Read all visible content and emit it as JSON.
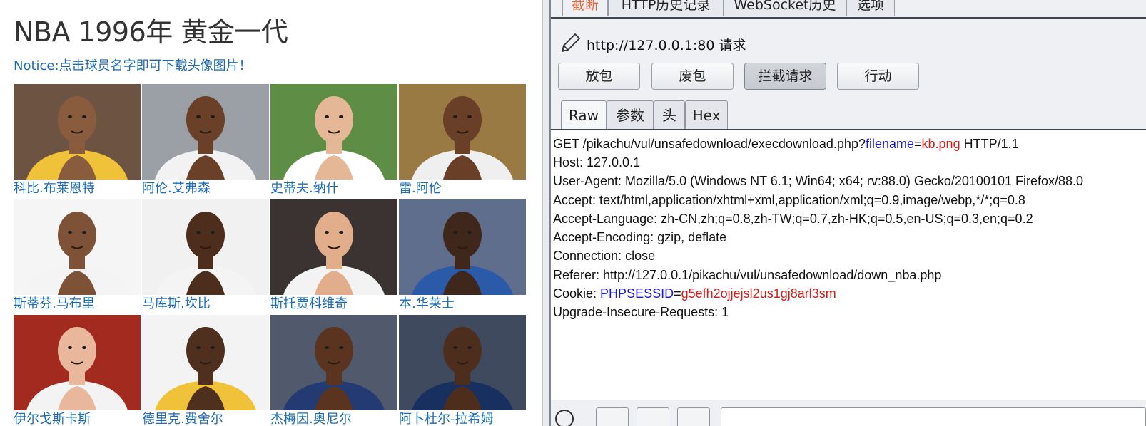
{
  "page": {
    "title": "NBA 1996年 黄金一代",
    "notice": "Notice:点击球员名字即可下载头像图片！",
    "players": [
      {
        "name": "科比.布莱恩特",
        "bg": "#6d5442",
        "skin": "#8a5c3e",
        "jersey": "#f0c23a"
      },
      {
        "name": "阿伦.艾弗森",
        "bg": "#9aa0a5",
        "skin": "#6a4128",
        "jersey": "#f2f2f2"
      },
      {
        "name": "史蒂夫.纳什",
        "bg": "#5e8d46",
        "skin": "#e4b796",
        "jersey": "#ffffff"
      },
      {
        "name": "雷.阿伦",
        "bg": "#9a7a43",
        "skin": "#6a3f27",
        "jersey": "#efefef"
      },
      {
        "name": "斯蒂芬.马布里",
        "bg": "#f5f5f5",
        "skin": "#7d5236",
        "jersey": "#f4f4f4"
      },
      {
        "name": "马库斯.坎比",
        "bg": "#f1f1f1",
        "skin": "#4d2d1c",
        "jersey": "#f4f4f4"
      },
      {
        "name": "斯托贾科维奇",
        "bg": "#3a3331",
        "skin": "#e1ad8a",
        "jersey": "#f3f3f3"
      },
      {
        "name": "本.华莱士",
        "bg": "#5f6e8c",
        "skin": "#3f271b",
        "jersey": "#2a5aa8"
      },
      {
        "name": "伊尔戈斯卡斯",
        "bg": "#a32a1e",
        "skin": "#e9b89c",
        "jersey": "#f3f3f3"
      },
      {
        "name": "德里克.费舍尔",
        "bg": "#f3f3f3",
        "skin": "#4f2f1d",
        "jersey": "#f0c23a"
      },
      {
        "name": "杰梅因.奥尼尔",
        "bg": "#505a6c",
        "skin": "#5a341f",
        "jersey": "#243a73"
      },
      {
        "name": "阿卜杜尔-拉希姆",
        "bg": "#404a5e",
        "skin": "#4d2d1c",
        "jersey": "#183060"
      }
    ]
  },
  "proxy": {
    "top_tabs": [
      "截断",
      "HTTP历史记录",
      "WebSocket历史",
      "选项"
    ],
    "request_label": "http://127.0.0.1:80 请求",
    "buttons": [
      "放包",
      "废包",
      "拦截请求",
      "行动"
    ],
    "sub_tabs": [
      "Raw",
      "参数",
      "头",
      "Hex"
    ],
    "request": {
      "line1_pre": "GET /pikachu/vul/unsafedownload/execdownload.php?",
      "line1_key": "filename",
      "line1_eq": "=",
      "line1_val": "kb.png",
      "line1_post": " HTTP/1.1",
      "host": "Host: 127.0.0.1",
      "user_agent": "User-Agent: Mozilla/5.0 (Windows NT 6.1; Win64; x64; rv:88.0) Gecko/20100101 Firefox/88.0",
      "accept": "Accept: text/html,application/xhtml+xml,application/xml;q=0.9,image/webp,*/*;q=0.8",
      "accept_language": "Accept-Language: zh-CN,zh;q=0.8,zh-TW;q=0.7,zh-HK;q=0.5,en-US;q=0.3,en;q=0.2",
      "accept_encoding": "Accept-Encoding: gzip, deflate",
      "connection": "Connection: close",
      "referer": "Referer: http://127.0.0.1/pikachu/vul/unsafedownload/down_nba.php",
      "cookie_label": "Cookie: ",
      "cookie_key": "PHPSESSID",
      "cookie_eq": "=",
      "cookie_val": "g5efh2ojjejsl2us1gj8arl3sm",
      "upgrade": "Upgrade-Insecure-Requests: 1"
    }
  }
}
